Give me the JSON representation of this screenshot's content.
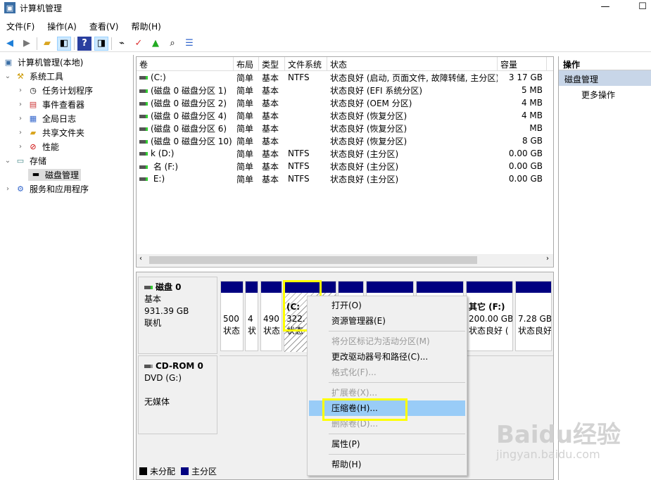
{
  "window": {
    "title": "计算机管理",
    "minimize": "—",
    "maximize": "☐"
  },
  "menu": [
    "文件(F)",
    "操作(A)",
    "查看(V)",
    "帮助(H)"
  ],
  "toolbar": [
    "back-icon",
    "forward-icon",
    "up-folder-icon",
    "show-tree-icon",
    "help-icon",
    "show-action-icon",
    "connect-icon",
    "check-icon",
    "folder-up-icon",
    "search-folder-icon",
    "properties-list-icon"
  ],
  "tree": {
    "root": "计算机管理(本地)",
    "system_tools": "系统工具",
    "items": [
      "任务计划程序",
      "事件查看器",
      "全局日志",
      "共享文件夹",
      "性能"
    ],
    "storage": "存储",
    "disk_mgmt": "磁盘管理",
    "services": "服务和应用程序"
  },
  "table": {
    "headers": [
      "卷",
      "布局",
      "类型",
      "文件系统",
      "状态",
      "容量"
    ],
    "rows": [
      [
        "(C:)",
        "简单",
        "基本",
        "NTFS",
        "状态良好 (启动, 页面文件, 故障转储, 主分区)",
        "3  17 GB"
      ],
      [
        "(磁盘 0 磁盘分区 1)",
        "简单",
        "基本",
        "",
        "状态良好 (EFI 系统分区)",
        "5  MB"
      ],
      [
        "(磁盘 0 磁盘分区 2)",
        "简单",
        "基本",
        "",
        "状态良好 (OEM 分区)",
        "4  MB"
      ],
      [
        "(磁盘 0 磁盘分区 4)",
        "简单",
        "基本",
        "",
        "状态良好 (恢复分区)",
        "4  MB"
      ],
      [
        "(磁盘 0 磁盘分区 6)",
        "简单",
        "基本",
        "",
        "状态良好 (恢复分区)",
        "  MB"
      ],
      [
        "(磁盘 0 磁盘分区 10)",
        "简单",
        "基本",
        "",
        "状态良好 (恢复分区)",
        "8 GB"
      ],
      [
        "k   (D:)",
        "简单",
        "基本",
        "NTFS",
        "状态良好 (主分区)",
        "0.00 GB"
      ],
      [
        "  名 (F:)",
        "简单",
        "基本",
        "NTFS",
        "状态良好 (主分区)",
        "0.00 GB"
      ],
      [
        "  E:)",
        "简单",
        "基本",
        "NTFS",
        "状态良好 (主分区)",
        "0.00 GB"
      ]
    ]
  },
  "disk0": {
    "name": "磁盘 0",
    "type": "基本",
    "size": "931.39 GB",
    "status": "联机",
    "partitions": [
      {
        "l1": "",
        "l2": "500",
        "l3": "状态"
      },
      {
        "l1": "",
        "l2": "4",
        "l3": "状"
      },
      {
        "l1": "",
        "l2": "490",
        "l3": "状态"
      },
      {
        "l1": "(C:",
        "l2": "322.",
        "l3": "状态"
      },
      {
        "l1": "",
        "l2": "",
        "l3": ""
      },
      {
        "l1": "",
        "l2": "",
        "l3": ""
      },
      {
        "l1": "",
        "l2": "",
        "l3": ""
      },
      {
        "l1": "其它  (F:)",
        "l2": "200.00 GB",
        "l3": "状态良好 ("
      },
      {
        "l1": "",
        "l2": "7.28 GB",
        "l3": "状态良好"
      }
    ]
  },
  "cdrom": {
    "name": "CD-ROM 0",
    "drive": "DVD (G:)",
    "status": "无媒体"
  },
  "legend": [
    "未分配",
    "主分区"
  ],
  "legend_colors": {
    "unallocated": "#000000",
    "primary": "#000080"
  },
  "actions": {
    "title": "操作",
    "section": "磁盘管理",
    "more": "更多操作"
  },
  "context_menu": {
    "open": "打开(O)",
    "explorer": "资源管理器(E)",
    "mark_active": "将分区标记为活动分区(M)",
    "change_letter": "更改驱动器号和路径(C)...",
    "format": "格式化(F)...",
    "extend": "扩展卷(X)...",
    "shrink": "压缩卷(H)...",
    "delete": "删除卷(D)...",
    "properties": "属性(P)",
    "help": "帮助(H)"
  },
  "watermark": "Baidu经验 jingyan.baidu.com"
}
